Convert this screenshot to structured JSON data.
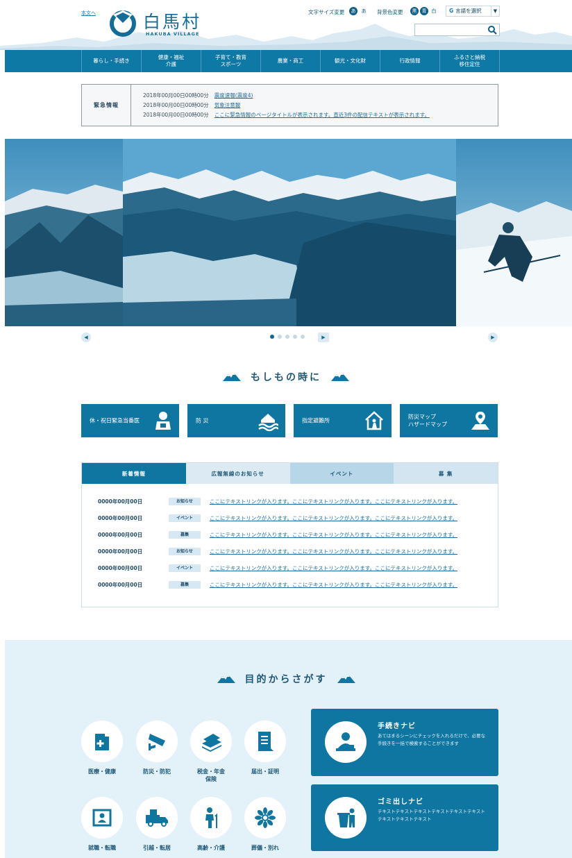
{
  "colors": {
    "brand": "#0f76a2",
    "brand_dark": "#0e5f87",
    "light_bg": "#e3f1f9"
  },
  "header": {
    "skip_link": "本文へ",
    "logo_title": "白馬村",
    "logo_subtitle": "HAKUBA VILLAGE",
    "font_size_label": "文字サイズ変更",
    "font_size_buttons": [
      "あ",
      "あ"
    ],
    "bg_color_label": "背景色変更",
    "bg_color_buttons": [
      "黒",
      "青",
      "白"
    ],
    "language_select": "言語を選択",
    "search_placeholder": ""
  },
  "nav": {
    "items": [
      "暮らし・手続き",
      "健康・福祉\n介護",
      "子育て・教育\nスポーツ",
      "農業・商工",
      "観光・文化財",
      "行政情報",
      "ふるさと納税\n移住定住"
    ]
  },
  "emergency": {
    "label": "緊急情報",
    "items": [
      {
        "datetime": "2018年00月00日00時00分",
        "title": "震度速報(震度4)"
      },
      {
        "datetime": "2018年00月00日00時00分",
        "title": "気象注意報"
      },
      {
        "datetime": "2018年00月00日00時00分",
        "title": "ここに緊急情報のページタイトルが表示されます。直近3件の配信テキストが表示されます。"
      }
    ]
  },
  "slider": {
    "prev": "◀",
    "next": "▶",
    "play": "▶",
    "dot_count": 5,
    "active_dot": 0
  },
  "moshimo": {
    "heading": "もしもの時に",
    "buttons": [
      {
        "label": "休・祝日緊急当番医",
        "icon": "doctor-icon"
      },
      {
        "label": "防 災",
        "icon": "flood-house-icon"
      },
      {
        "label": "指定避難所",
        "icon": "shelter-icon"
      },
      {
        "label": "防災マップ\nハザードマップ",
        "icon": "map-pin-icon"
      }
    ]
  },
  "news": {
    "tabs": [
      "新着情報",
      "広報無線のお知らせ",
      "イベント",
      "募 集"
    ],
    "active_tab": 0,
    "rows": [
      {
        "date": "0000年00月00日",
        "category": "お知らせ",
        "text": "ここにテキストリンクが入ります。ここにテキストリンクが入ります。ここにテキストリンクが入ります。"
      },
      {
        "date": "0000年00月00日",
        "category": "イベント",
        "text": "ここにテキストリンクが入ります。ここにテキストリンクが入ります。ここにテキストリンクが入ります。"
      },
      {
        "date": "0000年00月00日",
        "category": "募集",
        "text": "ここにテキストリンクが入ります。ここにテキストリンクが入ります。ここにテキストリンクが入ります。"
      },
      {
        "date": "0000年00月00日",
        "category": "お知らせ",
        "text": "ここにテキストリンクが入ります。ここにテキストリンクが入ります。ここにテキストリンクが入ります。"
      },
      {
        "date": "0000年00月00日",
        "category": "イベント",
        "text": "ここにテキストリンクが入ります。ここにテキストリンクが入ります。ここにテキストリンクが入ります。"
      },
      {
        "date": "0000年00月00日",
        "category": "募集",
        "text": "ここにテキストリンクが入ります。ここにテキストリンクが入ります。ここにテキストリンクが入ります。"
      }
    ]
  },
  "purpose": {
    "heading": "目的からさがす",
    "items": [
      {
        "label": "医療・健康",
        "icon": "hospital-icon"
      },
      {
        "label": "防災・防犯",
        "icon": "security-camera-icon"
      },
      {
        "label": "税金・年金\n保険",
        "icon": "money-icon"
      },
      {
        "label": "届出・証明",
        "icon": "certificate-icon"
      },
      {
        "label": "就職・転職",
        "icon": "job-change-icon"
      },
      {
        "label": "引越・転居",
        "icon": "moving-truck-icon"
      },
      {
        "label": "高齢・介護",
        "icon": "elderly-icon"
      },
      {
        "label": "葬儀・別れ",
        "icon": "chrysanthemum-icon"
      }
    ],
    "cards": [
      {
        "title": "手続きナビ",
        "desc": "あてはまるシーンにチェックを入れるだけで、必要な手続きを一括で検索することができます",
        "icon": "clerk-icon"
      },
      {
        "title": "ゴミ出しナビ",
        "desc": "テキストテキストテキストテキストテキストテキストテキストテキストテキスト",
        "icon": "garbage-icon"
      }
    ]
  }
}
